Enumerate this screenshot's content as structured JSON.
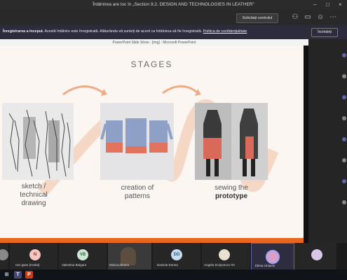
{
  "window": {
    "title": "Întâlnirea are loc în „Section 9.2. DESIGN AND TECHNOLOGIES IN LEATHER”"
  },
  "toolbar": {
    "request_control_label": "Solicitați controlul"
  },
  "banner": {
    "bold_text": "Înregistrarea a început.",
    "text": " Acestă întâlnire este înregistrată. Alăturându-vă sunteți de acord ca întâlnirea să fie înregistrată.",
    "link_text": "Politica de confidențialitate",
    "close_label": "Închideți"
  },
  "shared_window": {
    "title": "PowerPoint Slide Show - [img] - Microsoft PowerPoint"
  },
  "slide": {
    "heading": "STAGES",
    "stages": [
      {
        "line1": "sketch /",
        "line2": "technical",
        "line3": "drawing"
      },
      {
        "line1": "creation of",
        "line2": "patterns"
      },
      {
        "line1": "sewing the",
        "line2": "prototype"
      }
    ]
  },
  "participants": [
    {
      "initials": "N",
      "name": "nez.gase (Invitat)",
      "color": "#f4c7c3",
      "text_color": "#9e2b25"
    },
    {
      "initials": "VB",
      "name": "Valentina Bulgaru",
      "color": "#cde7d3",
      "text_color": "#2f6b3c"
    },
    {
      "initials": "",
      "name": "Mukucubkana",
      "color": "#6a5a4a",
      "text_color": "#fff"
    },
    {
      "initials": "DD",
      "name": "Daniela Donea",
      "color": "#c8dcef",
      "text_color": "#2a5d8a"
    },
    {
      "initials": "",
      "name": "Angela Scripcenco #3",
      "color": "#e8e0d0",
      "text_color": "#444"
    },
    {
      "initials": "",
      "name": "Elena Ursachi",
      "color": "#d8a0c8",
      "text_color": "#444"
    },
    {
      "initials": "",
      "name": "",
      "color": "#d9c6e8",
      "text_color": "#444"
    }
  ],
  "colors": {
    "accent": "#e9661f",
    "teams_purple": "#6264a7"
  }
}
